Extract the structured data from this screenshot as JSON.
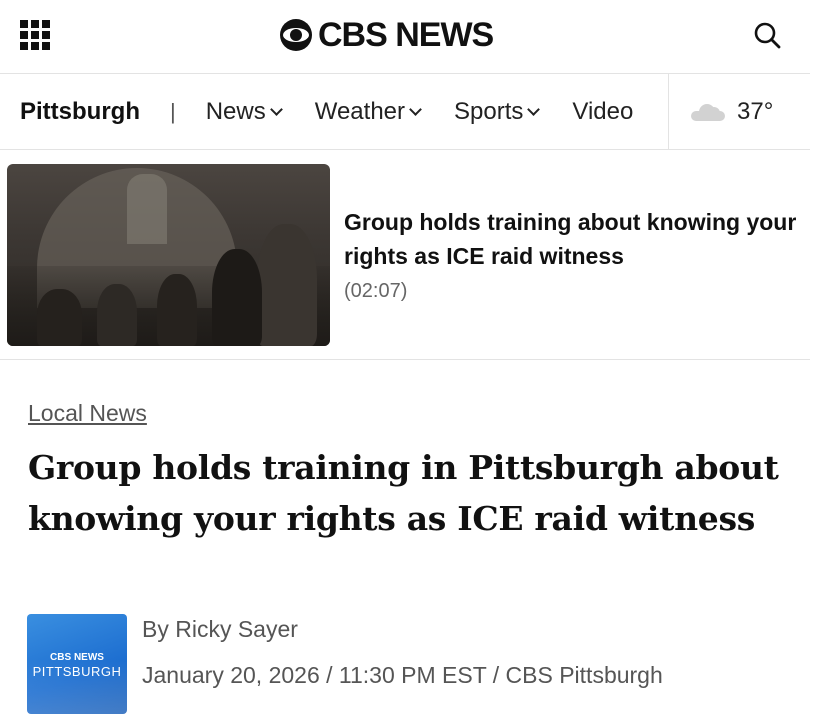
{
  "header": {
    "logo_text": "CBS NEWS",
    "menu_icon": "grid-menu-icon",
    "search_icon": "search-icon"
  },
  "nav": {
    "home": "Pittsburgh",
    "separator": "|",
    "items": [
      {
        "label": "News"
      },
      {
        "label": "Weather"
      },
      {
        "label": "Sports"
      },
      {
        "label": "Video"
      }
    ],
    "weather": {
      "icon": "cloud-icon",
      "temp": "37°"
    }
  },
  "video": {
    "title": "Group holds training about knowing your rights as ICE raid witness",
    "duration": "(02:07)"
  },
  "article": {
    "category": "Local News",
    "headline": "Group holds training in Pittsburgh about knowing your rights as ICE raid witness",
    "author_logo": {
      "line1": "CBS NEWS",
      "line2": "PITTSBURGH"
    },
    "byline": "By Ricky Sayer",
    "dateline": "January 20, 2026 / 11:30 PM EST / CBS Pittsburgh"
  },
  "colors": {
    "text": "#111111",
    "muted": "#555555",
    "border": "#e3e3e3",
    "logo_blue": "#1d6ed0"
  }
}
